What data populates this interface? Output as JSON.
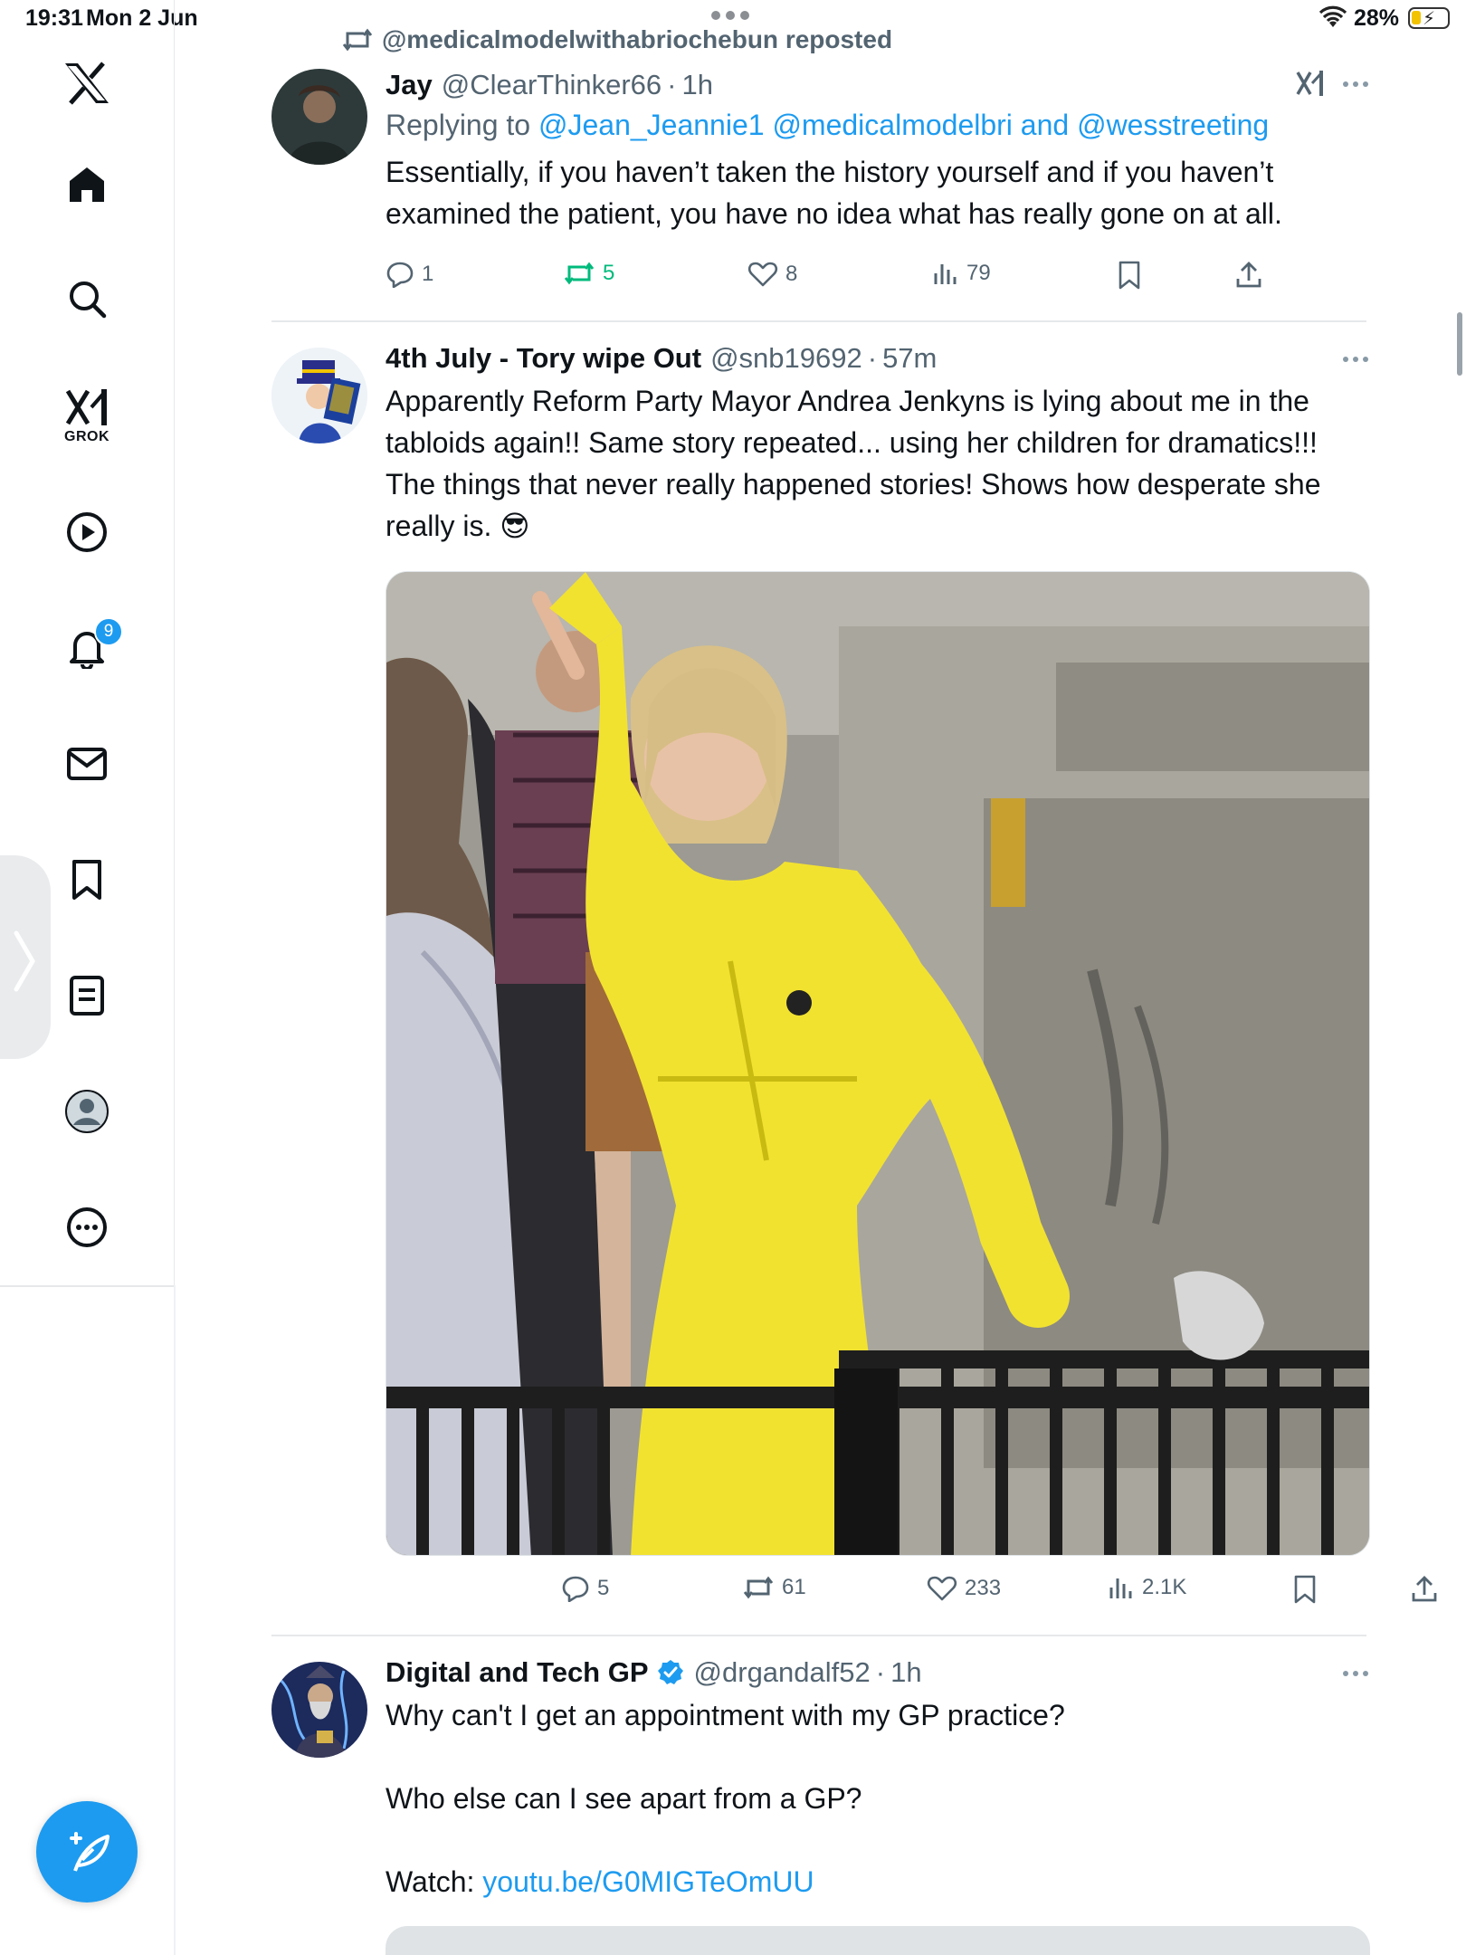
{
  "status_bar": {
    "time": "19:31",
    "date": "Mon 2 Jun",
    "battery": "28%",
    "battery_level": 0.28
  },
  "sidebar": {
    "items": [
      {
        "name": "x-logo",
        "label": ""
      },
      {
        "name": "home",
        "label": ""
      },
      {
        "name": "explore",
        "label": ""
      },
      {
        "name": "grok",
        "label": "GROK"
      },
      {
        "name": "video",
        "label": ""
      },
      {
        "name": "notifications",
        "label": "",
        "badge": "9"
      },
      {
        "name": "messages",
        "label": ""
      },
      {
        "name": "bookmarks",
        "label": ""
      },
      {
        "name": "lists",
        "label": ""
      },
      {
        "name": "profile",
        "label": ""
      },
      {
        "name": "more",
        "label": ""
      }
    ]
  },
  "feed": {
    "repost_banner": "@medicalmodelwithabriochebun reposted",
    "tweets": [
      {
        "name": "Jay",
        "handle": "@ClearThinker66",
        "time": "1h",
        "replying_prefix": "Replying to ",
        "replying_to": "@Jean_Jeannie1 @medicalmodelbri",
        "replying_and": " and ",
        "replying_last": "@wesstreeting",
        "text": "Essentially, if you haven’t taken the history yourself and if you haven’t examined the patient, you have no idea what has really gone on at all.",
        "replies": "1",
        "reposts": "5",
        "likes": "8",
        "views": "79"
      },
      {
        "name": "4th July - Tory wipe Out",
        "handle": "@snb19692",
        "time": "57m",
        "text": "Apparently Reform Party Mayor Andrea Jenkyns is lying about me in the tabloids again!! Same story repeated... using her children for dramatics!!! The things that never really happened stories! Shows how desperate she really is. 😎",
        "replies": "5",
        "reposts": "61",
        "likes": "233",
        "views": "2.1K"
      },
      {
        "name": "Digital and Tech GP",
        "handle": "@drgandalf52",
        "time": "1h",
        "text_1": "Why can't I get an appointment with my GP practice?",
        "text_2": "Who else can I see apart from a GP?",
        "text_3_prefix": "Watch: ",
        "text_3_link": "youtu.be/G0MIGTeOmUU"
      }
    ]
  },
  "colors": {
    "accent": "#1d9bf0",
    "repost_green": "#00ba7c",
    "secondary_text": "#536471"
  }
}
